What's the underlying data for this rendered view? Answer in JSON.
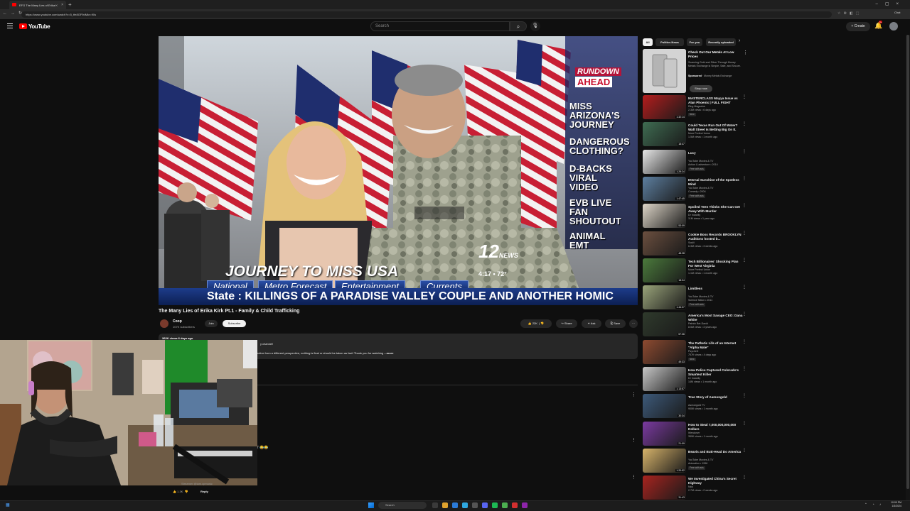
{
  "browser": {
    "tab_title": "EFG The Many Lies of Erika K",
    "url": "https://www.youtube.com/watch?v=5_tfe8GF9dMkr=90s",
    "profile_label": "Chat"
  },
  "header": {
    "logo_text": "YouTube",
    "search_placeholder": "Search",
    "create_label": "+ Create",
    "notification_count": "9+"
  },
  "video": {
    "rundown_heading_1": "THE",
    "rundown_heading_2": "RUNDOWN",
    "rundown_heading_3": "AHEAD",
    "rundown_items": [
      "MISS\nARIZONA'S\nJOURNEY",
      "DANGEROUS\nCLOTHING?",
      "D-BACKS\nVIRAL\nVIDEO",
      "EVB LIVE\nFAN\nSHOUTOUT",
      "ANIMAL\nEMT"
    ],
    "lower_third_title": "JOURNEY TO MISS USA",
    "station_number": "12",
    "station_name": "NEWS",
    "time_temp": "4:17 • 72°",
    "nav_tabs": [
      "National",
      "Metro Forecast",
      "Entertainment",
      "Currents"
    ],
    "ticker_text": "State : KILLINGS OF A PARADISE VALLEY COUPLE AND ANOTHER HOMIC",
    "title": "The Many Lies of Erika Kirk Pt.1 - Family & Child Trafficking"
  },
  "channel": {
    "name": "Coop",
    "subscribers": "107K subscribers",
    "join_label": "Join",
    "subscribe_label": "Subscribe"
  },
  "actions": {
    "likes": "22K",
    "share_label": "Share",
    "ask_label": "Ask",
    "save_label": "Save"
  },
  "description": {
    "meta": "362K views  6 days ago",
    "line1": "y channel!",
    "line2": "ective from a different perspective, nothing is final or should be taken as fact! Thank you for watching",
    "more_label": "...more"
  },
  "comments": {
    "emote_text": "7 😂😂",
    "likes": "1.3K",
    "reply_label": "Reply"
  },
  "webcam": {
    "caption": "Streamer @iam.cpmusic"
  },
  "sidebar": {
    "chips": [
      "All",
      "Politics News",
      "For you",
      "Recently uploaded"
    ],
    "ad": {
      "title": "Check Out Our Metals At Low Prices",
      "description": "Scanning Gold and Silver Through Money Metals Exchange is Simple, Safe, and Secure.",
      "sponsored": "Sponsored",
      "advertiser": "Money Metals Exchange",
      "button": "Shop now"
    },
    "videos": [
      {
        "title": "MASTERCLASS Mayya Issue vs Alan Phoenix | FULL FIGHT",
        "channel": "Ring Magazine",
        "meta": "2.3M views • 6 days ago",
        "badge": "New",
        "duration": "1:32:14",
        "thumb": "#b41d1d"
      },
      {
        "title": "Could Texas Run Out Of Water? Wall Street Is Betting Big On It.",
        "channel": "More Perfect Union",
        "meta": "1.5M views • 1 month ago",
        "badge": "",
        "duration": "18:47",
        "thumb": "#3f6c52"
      },
      {
        "title": "Lucy",
        "channel": "YouTube Movies & TV",
        "meta": "Action & adventure • 2014",
        "badge": "Free with ads",
        "duration": "1:29:24",
        "thumb": "#e8e8e8"
      },
      {
        "title": "Eternal Sunshine of the Spotless Mind",
        "channel": "YouTube Movies & TV",
        "meta": "Comedy • 2004",
        "badge": "Free with ads",
        "duration": "1:47:45",
        "thumb": "#5d7fa0"
      },
      {
        "title": "Spoiled Teen Thinks She Can Get Away With Murder",
        "channel": "Dr Insanity",
        "meta": "11M views • 1 year ago",
        "badge": "",
        "duration": "53:09",
        "thumb": "#ded6c8"
      },
      {
        "title": "Cookie Boss Records BROOKLYN Auditions hosted b...",
        "channel": "Soulii",
        "meta": "6.3M views • 3 weeks ago",
        "badge": "",
        "duration": "48:28",
        "thumb": "#6b4f3f"
      },
      {
        "title": "Tech Billionaires' Shocking Plan For West Virginia",
        "channel": "More Perfect Union",
        "meta": "1.1M views • 1 month ago",
        "badge": "",
        "duration": "18:04",
        "thumb": "#4b7a3c"
      },
      {
        "title": "Limitless",
        "channel": "YouTube Movies & TV",
        "meta": "Science fiction • 2011",
        "badge": "Free with ads",
        "duration": "1:44:37",
        "thumb": "#9aa47a"
      },
      {
        "title": "America's Most Savage CEO: Dana White",
        "channel": "Patrick Bet-David",
        "meta": "8.5M views • 3 years ago",
        "badge": "",
        "duration": "57:36",
        "thumb": "#2f3a2c"
      },
      {
        "title": "The Pathetic Life of an Internet \"Alpha Male\"",
        "channel": "PsycheD",
        "meta": "757K views • 4 days ago",
        "badge": "New",
        "duration": "49:33",
        "thumb": "#8d4a30"
      },
      {
        "title": "How Police Captured Colorado's Smartest Killer",
        "channel": "Dr Insanity",
        "meta": "14M views • 1 month ago",
        "badge": "",
        "duration": "1:13:57",
        "thumb": "#c7c7c7"
      },
      {
        "title": "True Story of Aamongold",
        "channel": "Asmongold TV",
        "meta": "900K views • 1 month ago",
        "badge": "",
        "duration": "30:34",
        "thumb": "#3d5a7a"
      },
      {
        "title": "How to Steal 7,000,000,000,000 Dollars",
        "channel": "Wendover",
        "meta": "359K views • 1 month ago",
        "badge": "",
        "duration": "21:09",
        "thumb": "#7a3aa0"
      },
      {
        "title": "Beavis and Butt-Head Do America",
        "channel": "YouTube Movies & TV",
        "meta": "Animation • 1996",
        "badge": "Free with ads",
        "duration": "1:20:52",
        "thumb": "#d7b36a"
      },
      {
        "title": "We Investigated China's Secret Highway",
        "channel": "Nick",
        "meta": "2.7M views • 2 weeks ago",
        "badge": "",
        "duration": "31:43",
        "thumb": "#a8241f"
      }
    ]
  },
  "taskbar": {
    "search_label": "Search",
    "time": "10:09 PM",
    "date": "1/3/2024"
  }
}
